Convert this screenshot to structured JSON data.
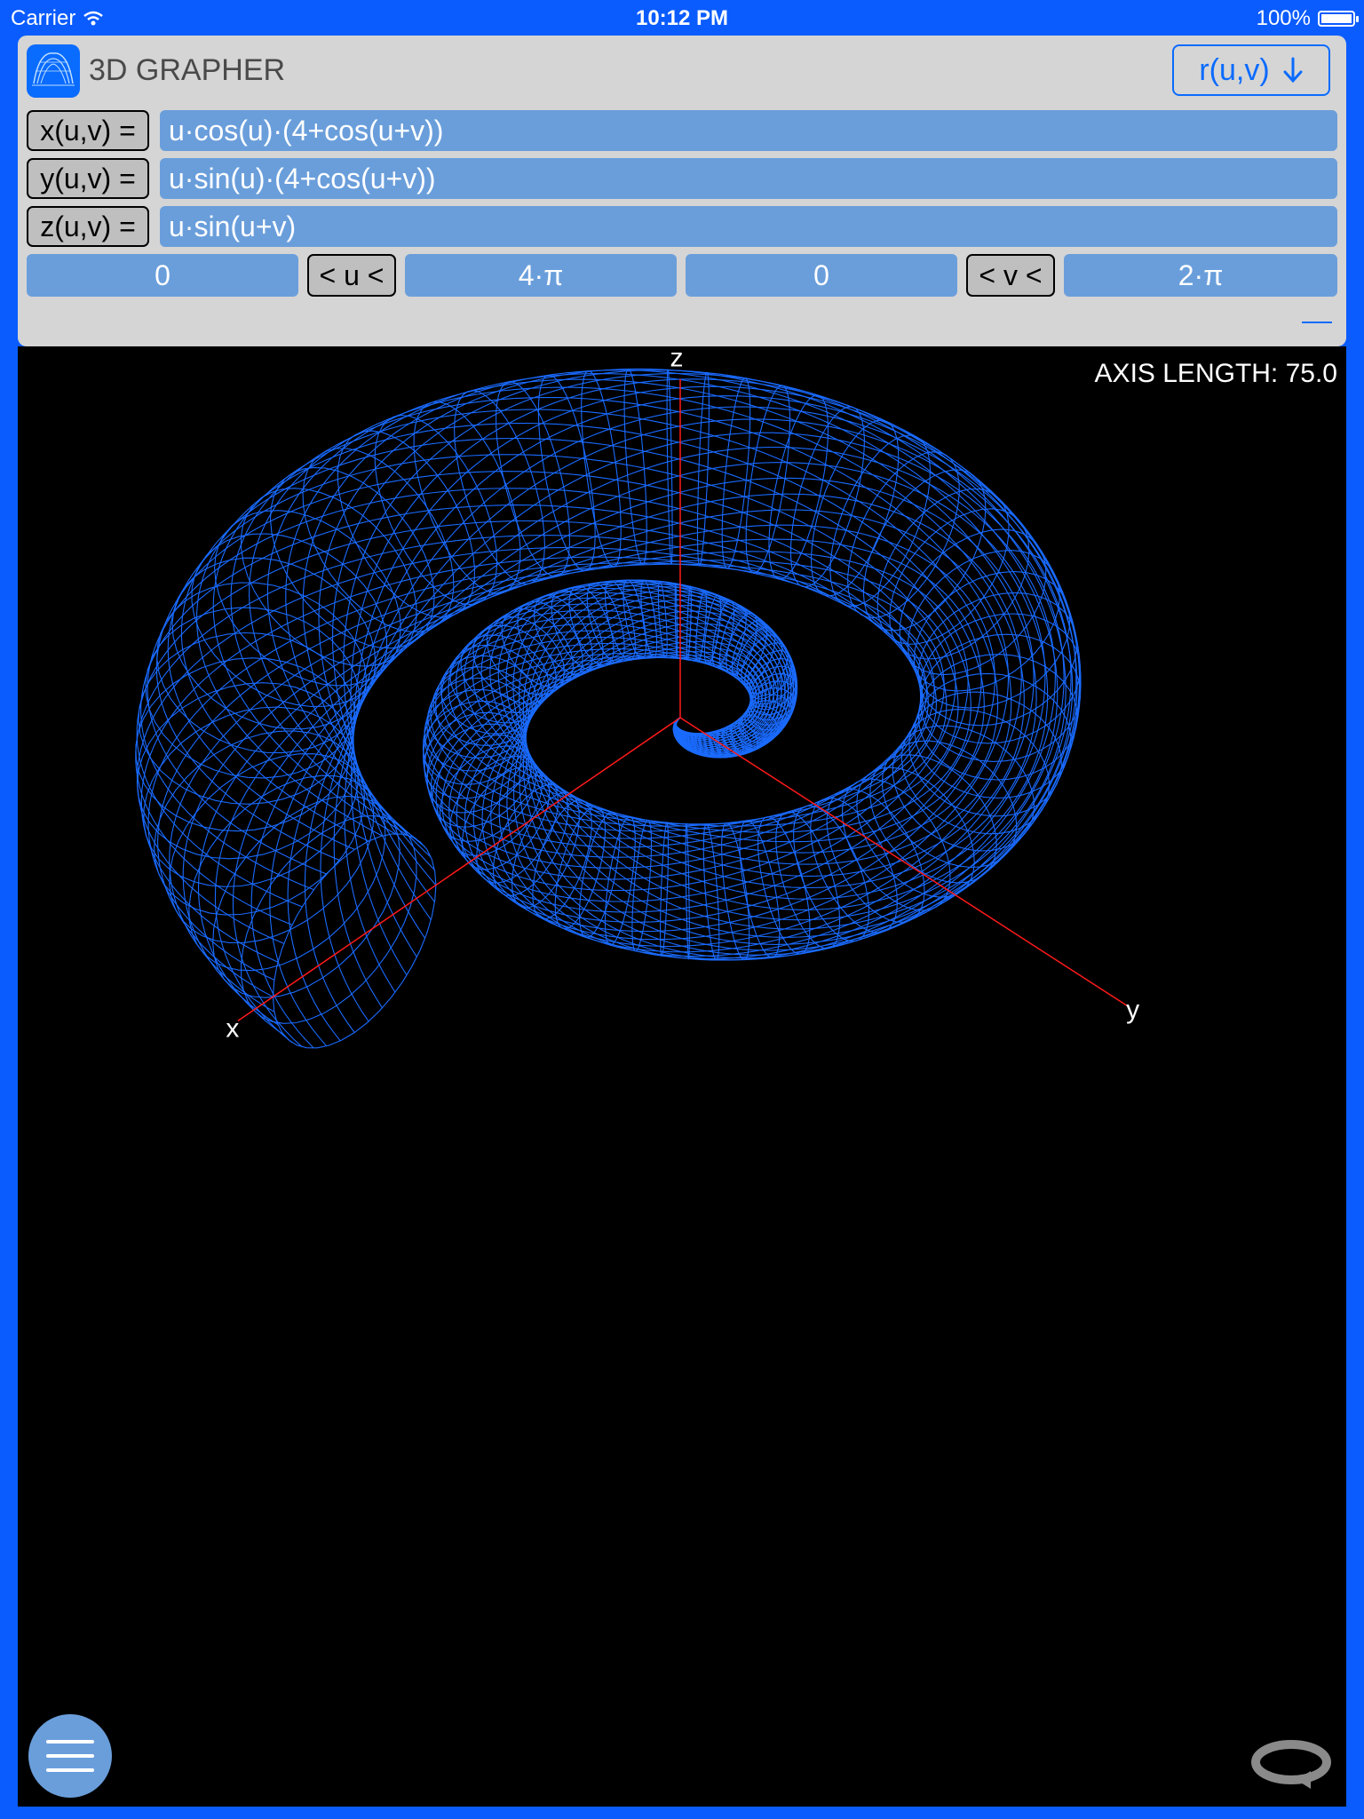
{
  "status_bar": {
    "carrier": "Carrier",
    "time": "10:12 PM",
    "battery": "100%",
    "battery_level": 1.0
  },
  "header": {
    "title": "3D GRAPHER",
    "logo_icon": "surface-graph-icon",
    "mode_button_label": "r(u,v)",
    "mode_button_icon": "arrow-down-icon"
  },
  "functions": [
    {
      "label": "x(u,v) =",
      "expression": "u·cos(u)·(4+cos(u+v))"
    },
    {
      "label": "y(u,v) =",
      "expression": "u·sin(u)·(4+cos(u+v))"
    },
    {
      "label": "z(u,v) =",
      "expression": "u·sin(u+v)"
    }
  ],
  "ranges": {
    "u_min": "0",
    "u_label": "< u <",
    "u_max": "4·π",
    "v_min": "0",
    "v_label": "< v <",
    "v_max": "2·π"
  },
  "graph": {
    "axis_length": "AXIS LENGTH: 75.0",
    "axis_labels": {
      "x": "x",
      "y": "y",
      "z": "z"
    },
    "surface_color": "#1a6bff",
    "axis_color": "#ff1a1a"
  },
  "controls": {
    "menu_icon": "hamburger-menu-icon",
    "rotate_icon": "rotate-icon"
  },
  "colors": {
    "frame": "#0a5cff",
    "panel": "#d5d5d5",
    "field": "#6a9edb",
    "accent": "#0a6bff"
  }
}
